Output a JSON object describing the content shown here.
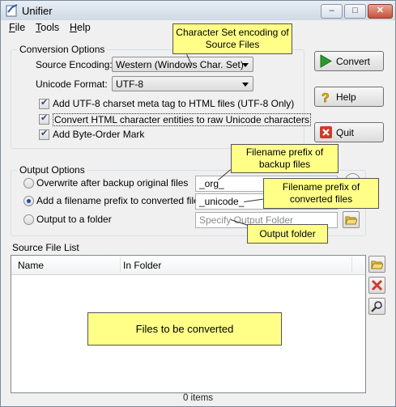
{
  "window": {
    "title": "Unifier"
  },
  "menu": [
    {
      "label": "File",
      "accel": "F",
      "rest": "ile"
    },
    {
      "label": "Tools",
      "accel": "T",
      "rest": "ools"
    },
    {
      "label": "Help",
      "accel": "H",
      "rest": "elp"
    }
  ],
  "conversion": {
    "group_label": "Conversion Options",
    "source_encoding_label": "Source Encoding:",
    "source_encoding_value": "Western (Windows Char. Set)",
    "unicode_format_label": "Unicode Format:",
    "unicode_format_value": "UTF-8",
    "opt_meta_tag": "Add UTF-8 charset meta tag to HTML files (UTF-8 Only)",
    "opt_entities": "Convert HTML character entities to raw Unicode characters",
    "opt_bom": "Add Byte-Order Mark"
  },
  "buttons": {
    "convert": "Convert",
    "help": "Help",
    "quit": "Quit"
  },
  "output": {
    "group_label": "Output Options",
    "overwrite_label": "Overwrite after backup original files",
    "overwrite_value": "_org_",
    "prefix_label": "Add a filename prefix to converted files",
    "prefix_value": "_unicode_",
    "folder_label": "Output to a folder",
    "folder_placeholder": "Specify Output Folder"
  },
  "source_list": {
    "label": "Source File List",
    "columns": [
      "Name",
      "In Folder"
    ],
    "status": "0 items"
  },
  "callouts": {
    "charset": "Character Set encoding of Source Files",
    "backup_prefix": "Filename prefix of backup files",
    "converted_prefix": "Filename prefix of converted files",
    "output_folder": "Output folder",
    "files": "Files to be converted"
  },
  "colors": {
    "callout_bg": "#ffff88",
    "convert_arrow": "#2e9a2e",
    "quit_x": "#d23a2a",
    "help_icon": "#e8b800"
  }
}
